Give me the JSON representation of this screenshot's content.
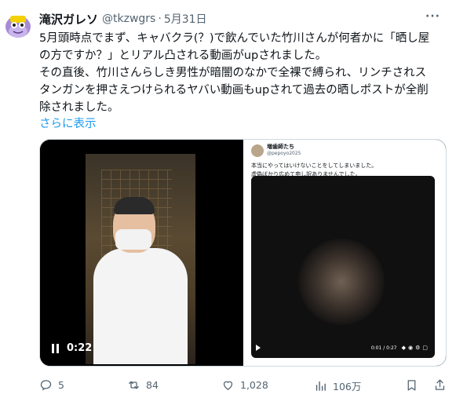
{
  "tweet": {
    "display_name": "滝沢ガレソ",
    "handle": "@tkzwgrs",
    "separator": "·",
    "date": "5月31日",
    "more": "···",
    "text_lines": [
      "5月頭時点でまず、キャバクラ(？)で飲んでいた竹川さんが何者かに「晒し屋",
      "の方ですか？」とリアル凸される動画がupされました。",
      "その直後、竹川さんらしき男性が暗闇のなかで全裸で縛られ、リンチされス",
      "タンガンを押さえつけられるヤバい動画もupされて過去の晒しポストが全削",
      "除されました。"
    ],
    "show_more": "さらに表示"
  },
  "media": {
    "left_video": {
      "time": "0:22"
    },
    "right_card": {
      "name": "増歯師たち",
      "handle": "@pepoyo2025",
      "text_lines": [
        "本当にやってはいけないことをしてしまいました。",
        "虚偽ばかり広めて申し訳ありませんでした。"
      ],
      "inner_time": "0:01 / 0:27"
    }
  },
  "actions": {
    "replies": "5",
    "reposts": "84",
    "likes": "1,028",
    "views": "106万"
  },
  "colors": {
    "accent": "#1d9bf0",
    "secondary_text": "#536471",
    "avatar_bg": "#b7a6d9"
  }
}
